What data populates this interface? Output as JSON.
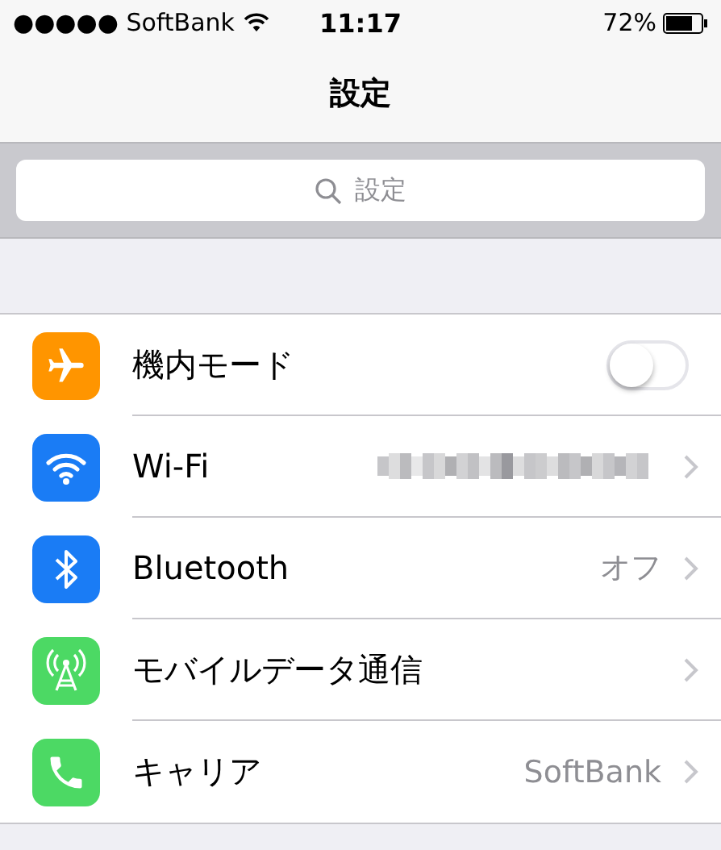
{
  "status_bar": {
    "carrier": "●●●●● SoftBank",
    "time": "11:17",
    "battery": "72%"
  },
  "nav": {
    "title": "設定"
  },
  "search": {
    "placeholder": "設定"
  },
  "rows": [
    {
      "label": "機内モード",
      "kind": "toggle",
      "on": false,
      "color": "#ff9500"
    },
    {
      "label": "Wi-Fi",
      "kind": "redacted",
      "color": "#1a7cf5"
    },
    {
      "label": "Bluetooth",
      "kind": "link",
      "value": "オフ",
      "color": "#1a7cf5"
    },
    {
      "label": "モバイルデータ通信",
      "kind": "link",
      "color": "#4cd964"
    },
    {
      "label": "キャリア",
      "kind": "link",
      "value": "SoftBank",
      "color": "#4cd964"
    }
  ]
}
